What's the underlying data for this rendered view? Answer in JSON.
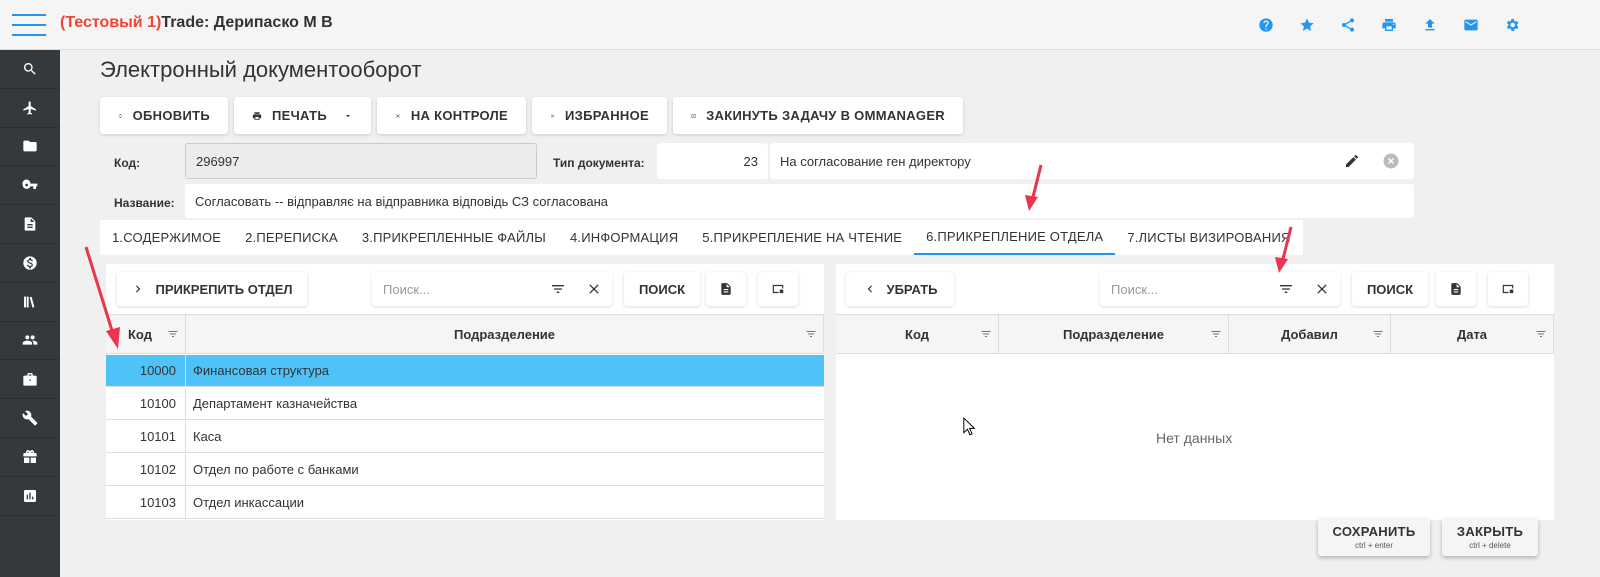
{
  "header": {
    "title_prefix": "(Тестовый 1)",
    "title": "Trade: Дерипаско М В",
    "icons": [
      "help-icon",
      "star-icon",
      "share-icon",
      "print-icon",
      "upload-icon",
      "mail-icon",
      "settings-icon"
    ]
  },
  "sidebar": {
    "icons": [
      "search-icon",
      "plane-icon",
      "folder-icon",
      "key-icon",
      "document-icon",
      "dollar-icon",
      "books-icon",
      "people-icon",
      "briefcase-icon",
      "wrench-icon",
      "gift-icon",
      "chart-icon"
    ]
  },
  "page": {
    "title": "Электронный документооборот"
  },
  "toolbar": {
    "refresh": "ОБНОВИТЬ",
    "print": "ПЕЧАТЬ",
    "control": "НА КОНТРОЛЕ",
    "favorites": "ИЗБРАННОЕ",
    "ommanager": "ЗАКИНУТЬ ЗАДАЧУ В OMMANAGER"
  },
  "form": {
    "code_label": "Код:",
    "code_value": "296997",
    "doc_type_label": "Тип документа:",
    "doc_type_code": "23",
    "doc_type_name": "На согласование ген директору",
    "name_label": "Название:",
    "name_value": "Согласовать -- відправляє на відправника відповідь СЗ согласована"
  },
  "tabs": [
    "1.СОДЕРЖИМОЕ",
    "2.ПЕРЕПИСКА",
    "3.ПРИКРЕПЛЕННЫЕ ФАЙЛЫ",
    "4.ИНФОРМАЦИЯ",
    "5.ПРИКРЕПЛЕНИЕ НА ЧТЕНИЕ",
    "6.ПРИКРЕПЛЕНИЕ ОТДЕЛА",
    "7.ЛИСТЫ ВИЗИРОВАНИЯ"
  ],
  "active_tab": 5,
  "left_panel": {
    "attach_button": "ПРИКРЕПИТЬ ОТДЕЛ",
    "search_placeholder": "Поиск...",
    "search_button": "ПОИСК",
    "columns": [
      "Код",
      "Подразделение"
    ],
    "rows": [
      {
        "code": "10000",
        "name": "Финансовая структура",
        "selected": true
      },
      {
        "code": "10100",
        "name": "Департамент казначейства",
        "selected": false
      },
      {
        "code": "10101",
        "name": "Каса",
        "selected": false
      },
      {
        "code": "10102",
        "name": "Отдел по работе с банками",
        "selected": false
      },
      {
        "code": "10103",
        "name": "Отдел инкассации",
        "selected": false
      }
    ]
  },
  "right_panel": {
    "remove_button": "УБРАТЬ",
    "search_placeholder": "Поиск...",
    "search_button": "ПОИСК",
    "columns": [
      "Код",
      "Подразделение",
      "Добавил",
      "Дата"
    ],
    "empty_text": "Нет данных"
  },
  "footer": {
    "save": "СОХРАНИТЬ",
    "save_hint": "ctrl + enter",
    "close": "ЗАКРЫТЬ",
    "close_hint": "ctrl + delete"
  },
  "colors": {
    "accent": "#2196f3",
    "selected_row": "#4fc3f7",
    "test_label": "#f44336",
    "sidebar": "#34393e",
    "annotation_arrow": "#e8364f"
  }
}
